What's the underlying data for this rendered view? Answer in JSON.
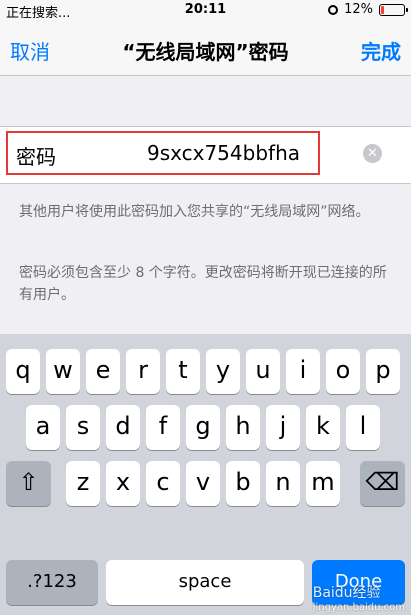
{
  "status_bar": {
    "carrier_text": "正在搜索...",
    "time": "20:11",
    "battery": "12%"
  },
  "navbar": {
    "cancel": "取消",
    "title": "“无线局域网”密码",
    "done": "完成"
  },
  "password_field": {
    "label": "密码",
    "value": "9sxcx754bbfha"
  },
  "notes": {
    "share": "其他用户将使用此密码加入您共享的“无线局域网”网络。",
    "requirement": "密码必须包含至少 8 个字符。更改密码将断开现已连接的所有用户。"
  },
  "keyboard": {
    "row1": [
      "q",
      "w",
      "e",
      "r",
      "t",
      "y",
      "u",
      "i",
      "o",
      "p"
    ],
    "row2": [
      "a",
      "s",
      "d",
      "f",
      "g",
      "h",
      "j",
      "k",
      "l"
    ],
    "row3": [
      "z",
      "x",
      "c",
      "v",
      "b",
      "n",
      "m"
    ],
    "shift": "⇧",
    "delete": "⌫",
    "numbers": ".?123",
    "space": "space",
    "done": "Done"
  },
  "watermark": {
    "brand": "Baidu经验",
    "url": "jingyan.baidu.com"
  },
  "colors": {
    "accent": "#007aff",
    "highlight_border": "#e53935",
    "battery_low": "#ff3b30"
  }
}
